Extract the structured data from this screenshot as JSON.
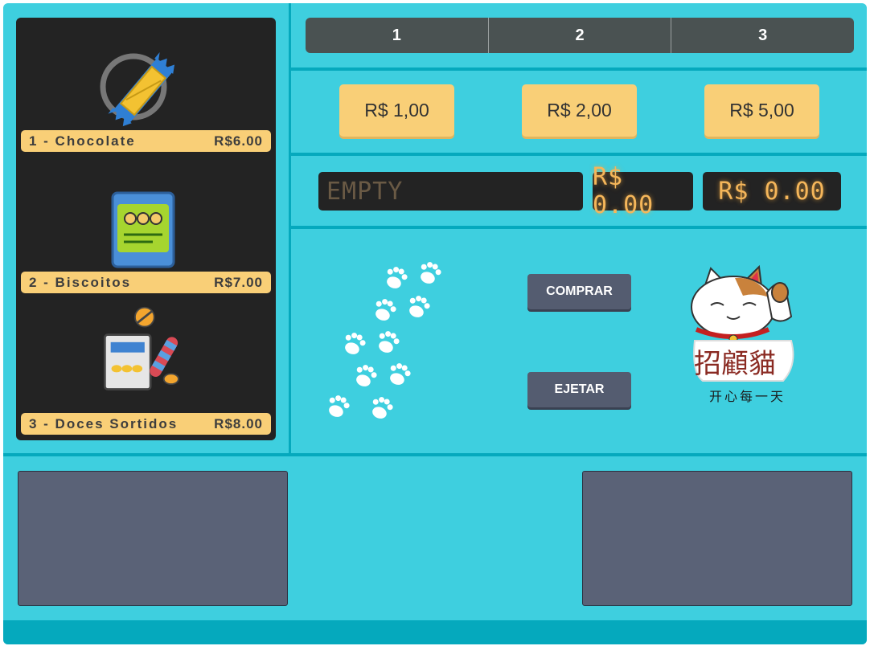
{
  "products": [
    {
      "label": "1 - Chocolate",
      "price": "R$6.00",
      "icon": "chocolate-bar-icon"
    },
    {
      "label": "2 - Biscoitos",
      "price": "R$7.00",
      "icon": "cookie-bag-icon"
    },
    {
      "label": "3 - Doces Sortidos",
      "price": "R$8.00",
      "icon": "assorted-candy-icon"
    }
  ],
  "selector": [
    "1",
    "2",
    "3"
  ],
  "coins": [
    "R$ 1,00",
    "R$ 2,00",
    "R$ 5,00"
  ],
  "displays": {
    "status": "EMPTY",
    "price": "R$ 0.00",
    "balance": "R$ 0.00"
  },
  "actions": {
    "buy": "COMPRAR",
    "eject": "EJETAR"
  },
  "mascot": {
    "name_chars": "招顧貓",
    "caption": "开心每一天",
    "icon": "lucky-cat-icon"
  },
  "colors": {
    "machine": "#3ecfdf",
    "divider": "#05a9bd",
    "label": "#f9cf77",
    "button": "#545c70",
    "display_text": "#f5b65a"
  }
}
